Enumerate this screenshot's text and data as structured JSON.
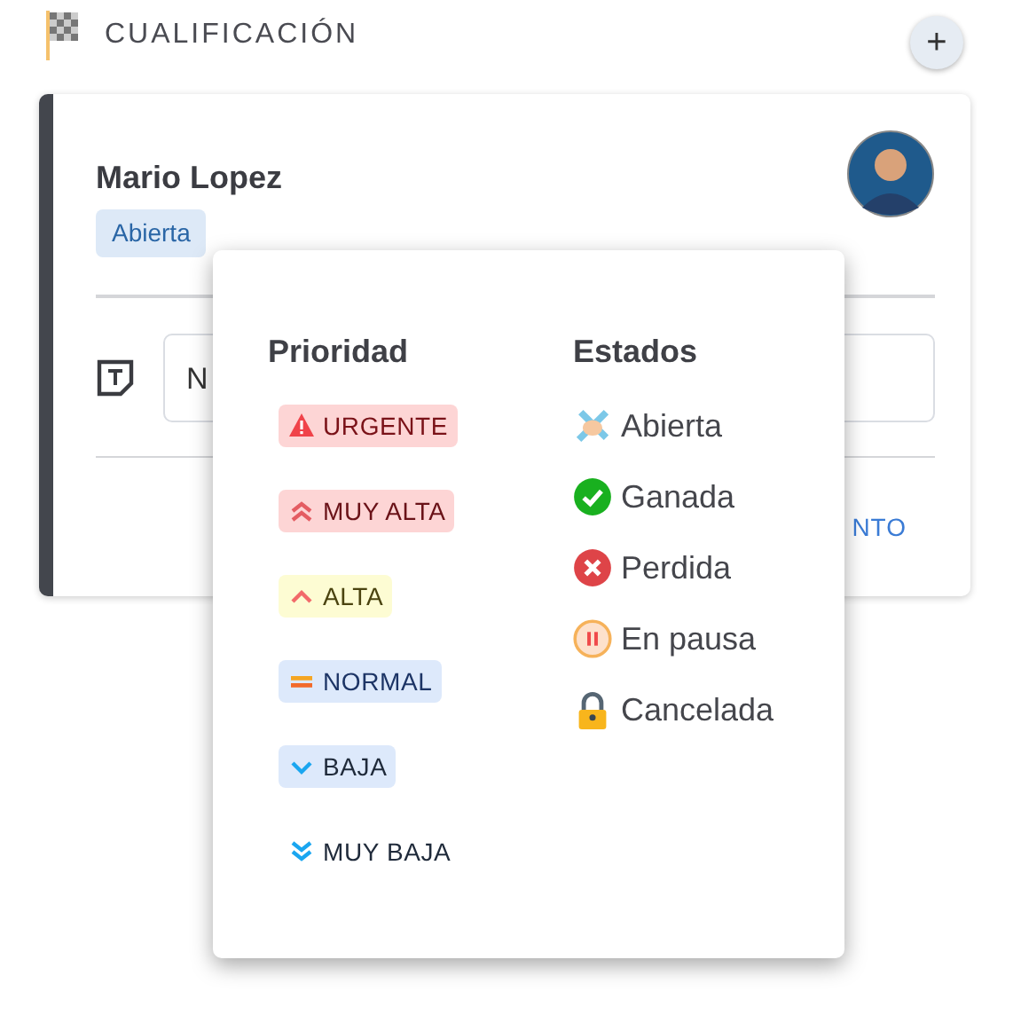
{
  "section": {
    "title": "CUALIFICACIÓN",
    "add_button": "+"
  },
  "card": {
    "name": "Mario Lopez",
    "status_badge": "Abierta",
    "note_field_value": "N",
    "link": "NTO"
  },
  "popover": {
    "priority_heading": "Prioridad",
    "states_heading": "Estados",
    "priorities": [
      {
        "kind": "urgent",
        "label": "URGENTE",
        "color": "#fdd5d5"
      },
      {
        "kind": "very-high",
        "label": "MUY ALTA",
        "color": "#fdd5d5"
      },
      {
        "kind": "high",
        "label": "ALTA",
        "color": "#fdfcd3"
      },
      {
        "kind": "normal",
        "label": "NORMAL",
        "color": "#dde9fb"
      },
      {
        "kind": "low",
        "label": "BAJA",
        "color": "#dde9fb"
      },
      {
        "kind": "very-low",
        "label": "MUY BAJA"
      }
    ],
    "states": [
      {
        "kind": "open",
        "label": "Abierta"
      },
      {
        "kind": "won",
        "label": "Ganada"
      },
      {
        "kind": "lost",
        "label": "Perdida"
      },
      {
        "kind": "paused",
        "label": "En pausa"
      },
      {
        "kind": "cancelled",
        "label": "Cancelada"
      }
    ]
  }
}
